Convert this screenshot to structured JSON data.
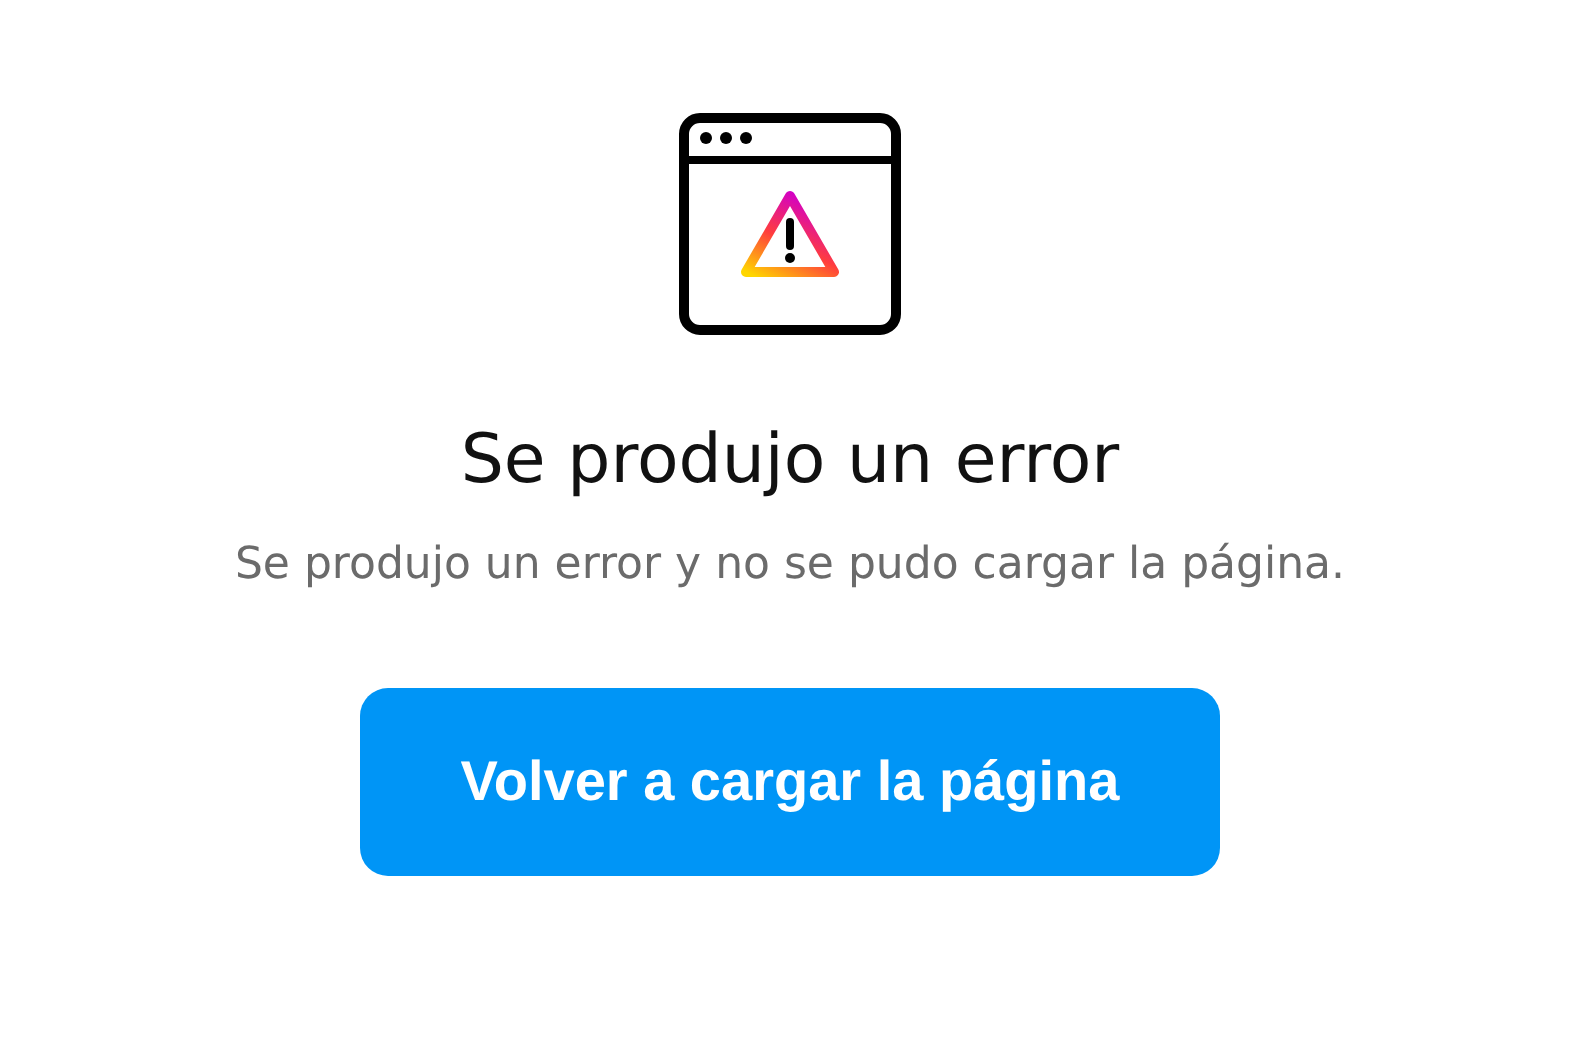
{
  "title": "Se produjo un error",
  "message": "Se produjo un error y no se pudo cargar la página.",
  "button": {
    "label": "Volver a cargar la página"
  }
}
